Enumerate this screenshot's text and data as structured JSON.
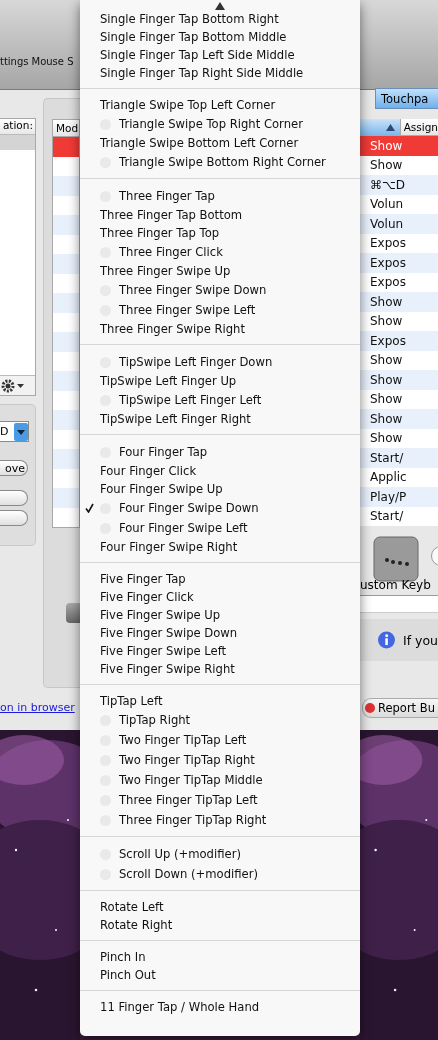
{
  "window": {
    "toolbar": [
      "ttings",
      "Mouse S"
    ],
    "left_panel": {
      "column_header": "ation:",
      "popup_value": "D",
      "button": "ove"
    },
    "middle_table": {
      "column_header": "Mod"
    },
    "link": "on in browser",
    "tab": {
      "label": "Touchpa",
      "selected": true
    },
    "table": {
      "column": "Assign",
      "rows": [
        {
          "action": "Show",
          "selected": true
        },
        {
          "action": "Show",
          "selected": false
        },
        {
          "action": "⌘⌥D",
          "selected": false
        },
        {
          "action": "Volun",
          "selected": false
        },
        {
          "action": "Volun",
          "selected": false
        },
        {
          "action": "Expos",
          "selected": false
        },
        {
          "action": "Expos",
          "selected": false
        },
        {
          "action": "Expos",
          "selected": false
        },
        {
          "action": "Show",
          "selected": false
        },
        {
          "action": "Show",
          "selected": false
        },
        {
          "action": "Expos",
          "selected": false
        },
        {
          "action": "Show",
          "selected": false
        },
        {
          "action": "Show",
          "selected": false
        },
        {
          "action": "Show",
          "selected": false
        },
        {
          "action": "Show",
          "selected": false
        },
        {
          "action": "Show",
          "selected": false
        },
        {
          "action": "Start/",
          "selected": false
        },
        {
          "action": "Applic",
          "selected": false
        },
        {
          "action": "Play/P",
          "selected": false
        },
        {
          "action": "Start/",
          "selected": false
        }
      ]
    },
    "radio": {
      "selected": false
    },
    "custom_label": "ustom Keyb",
    "info": "If you",
    "report_button": "Report Bu"
  },
  "menu": {
    "groups": [
      {
        "items": [
          {
            "label": "Single Finger Tap Bottom Right",
            "marked": false,
            "checked": false
          },
          {
            "label": "Single Finger Tap Bottom Middle",
            "marked": false,
            "checked": false
          },
          {
            "label": "Single Finger Tap Left Side Middle",
            "marked": false,
            "checked": false
          },
          {
            "label": "Single Finger Tap Right Side Middle",
            "marked": false,
            "checked": false
          }
        ]
      },
      {
        "items": [
          {
            "label": "Triangle Swipe Top Left Corner",
            "marked": false,
            "checked": false
          },
          {
            "label": "Triangle Swipe Top Right Corner",
            "marked": true,
            "checked": false
          },
          {
            "label": "Triangle Swipe Bottom Left Corner",
            "marked": false,
            "checked": false
          },
          {
            "label": "Triangle Swipe Bottom Right Corner",
            "marked": true,
            "checked": false
          }
        ]
      },
      {
        "items": [
          {
            "label": "Three Finger Tap",
            "marked": true,
            "checked": false
          },
          {
            "label": "Three Finger Tap Bottom",
            "marked": false,
            "checked": false
          },
          {
            "label": "Three Finger Tap Top",
            "marked": false,
            "checked": false
          },
          {
            "label": "Three Finger Click",
            "marked": true,
            "checked": false
          },
          {
            "label": "Three Finger Swipe Up",
            "marked": false,
            "checked": false
          },
          {
            "label": "Three Finger Swipe Down",
            "marked": true,
            "checked": false
          },
          {
            "label": "Three Finger Swipe Left",
            "marked": true,
            "checked": false
          },
          {
            "label": "Three Finger Swipe Right",
            "marked": false,
            "checked": false
          }
        ]
      },
      {
        "items": [
          {
            "label": "TipSwipe Left Finger Down",
            "marked": true,
            "checked": false
          },
          {
            "label": "TipSwipe Left Finger Up",
            "marked": false,
            "checked": false
          },
          {
            "label": "TipSwipe Left Finger Left",
            "marked": true,
            "checked": false
          },
          {
            "label": "TipSwipe Left Finger Right",
            "marked": false,
            "checked": false
          }
        ]
      },
      {
        "items": [
          {
            "label": "Four Finger Tap",
            "marked": true,
            "checked": false
          },
          {
            "label": "Four Finger Click",
            "marked": false,
            "checked": false
          },
          {
            "label": "Four Finger Swipe Up",
            "marked": false,
            "checked": false
          },
          {
            "label": "Four Finger Swipe Down",
            "marked": true,
            "checked": true
          },
          {
            "label": "Four Finger Swipe Left",
            "marked": true,
            "checked": false
          },
          {
            "label": "Four Finger Swipe Right",
            "marked": false,
            "checked": false
          }
        ]
      },
      {
        "items": [
          {
            "label": "Five Finger Tap",
            "marked": false,
            "checked": false
          },
          {
            "label": "Five Finger Click",
            "marked": false,
            "checked": false
          },
          {
            "label": "Five Finger Swipe Up",
            "marked": false,
            "checked": false
          },
          {
            "label": "Five Finger Swipe Down",
            "marked": false,
            "checked": false
          },
          {
            "label": "Five Finger Swipe Left",
            "marked": false,
            "checked": false
          },
          {
            "label": "Five Finger Swipe Right",
            "marked": false,
            "checked": false
          }
        ]
      },
      {
        "items": [
          {
            "label": "TipTap Left",
            "marked": false,
            "checked": false
          },
          {
            "label": "TipTap Right",
            "marked": true,
            "checked": false
          },
          {
            "label": "Two Finger TipTap Left",
            "marked": true,
            "checked": false
          },
          {
            "label": "Two Finger TipTap Right",
            "marked": true,
            "checked": false
          },
          {
            "label": "Two Finger TipTap Middle",
            "marked": true,
            "checked": false
          },
          {
            "label": "Three Finger TipTap Left",
            "marked": true,
            "checked": false
          },
          {
            "label": "Three Finger TipTap Right",
            "marked": true,
            "checked": false
          }
        ]
      },
      {
        "items": [
          {
            "label": "Scroll Up (+modifier)",
            "marked": true,
            "checked": false
          },
          {
            "label": "Scroll Down (+modifier)",
            "marked": true,
            "checked": false
          }
        ]
      },
      {
        "items": [
          {
            "label": "Rotate Left",
            "marked": false,
            "checked": false
          },
          {
            "label": "Rotate Right",
            "marked": false,
            "checked": false
          }
        ]
      },
      {
        "items": [
          {
            "label": "Pinch In",
            "marked": false,
            "checked": false
          },
          {
            "label": "Pinch Out",
            "marked": false,
            "checked": false
          }
        ]
      },
      {
        "items": [
          {
            "label": "11 Finger Tap / Whole Hand",
            "marked": false,
            "checked": false
          }
        ]
      }
    ]
  }
}
